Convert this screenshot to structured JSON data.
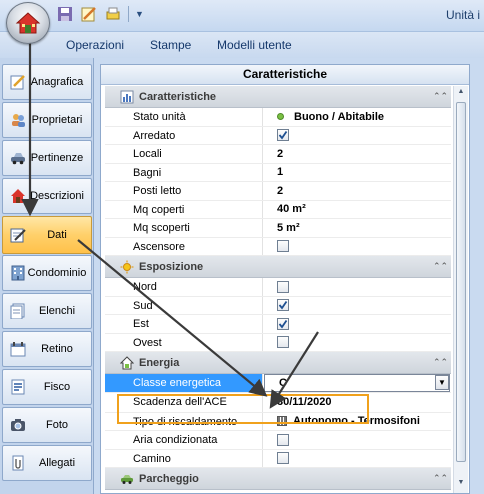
{
  "window": {
    "title": "Unità i"
  },
  "ribbon": {
    "tabs": [
      "Operazioni",
      "Stampe",
      "Modelli utente"
    ]
  },
  "nav": {
    "items": [
      {
        "label": "Anagrafica",
        "icon": "edit-icon"
      },
      {
        "label": "Proprietari",
        "icon": "people-icon"
      },
      {
        "label": "Pertinenze",
        "icon": "car-icon"
      },
      {
        "label": "Descrizioni",
        "icon": "house-icon"
      },
      {
        "label": "Dati",
        "icon": "notepad-icon",
        "active": true
      },
      {
        "label": "Condominio",
        "icon": "building-icon"
      },
      {
        "label": "Elenchi",
        "icon": "list-icon"
      },
      {
        "label": "Retino",
        "icon": "calendar-icon"
      },
      {
        "label": "Fisco",
        "icon": "fisco-icon"
      },
      {
        "label": "Foto",
        "icon": "camera-icon"
      },
      {
        "label": "Allegati",
        "icon": "attachment-icon"
      }
    ]
  },
  "panel": {
    "title": "Caratteristiche",
    "categories": [
      {
        "name": "Caratteristiche",
        "icon": "chart-icon",
        "rows": [
          {
            "key": "Stato unità",
            "value": "Buono / Abitabile",
            "type": "status"
          },
          {
            "key": "Arredato",
            "checked": true,
            "type": "check"
          },
          {
            "key": "Locali",
            "value": "2",
            "type": "text"
          },
          {
            "key": "Bagni",
            "value": "1",
            "type": "text"
          },
          {
            "key": "Posti letto",
            "value": "2",
            "type": "text"
          },
          {
            "key": "Mq coperti",
            "value": "40 m²",
            "type": "text"
          },
          {
            "key": "Mq scoperti",
            "value": "5 m²",
            "type": "text"
          },
          {
            "key": "Ascensore",
            "checked": false,
            "type": "check"
          }
        ]
      },
      {
        "name": "Esposizione",
        "icon": "sun-icon",
        "rows": [
          {
            "key": "Nord",
            "checked": false,
            "type": "check"
          },
          {
            "key": "Sud",
            "checked": true,
            "type": "check"
          },
          {
            "key": "Est",
            "checked": true,
            "type": "check"
          },
          {
            "key": "Ovest",
            "checked": false,
            "type": "check"
          }
        ]
      },
      {
        "name": "Energia",
        "icon": "energy-house-icon",
        "rows": [
          {
            "key": "Classe energetica",
            "value": "C",
            "type": "select",
            "selected": true
          },
          {
            "key": "Scadenza dell'ACE",
            "value": "30/11/2020",
            "type": "text"
          },
          {
            "key": "Tipo di riscaldamento",
            "value": "Autonomo - Termosifoni",
            "type": "heating"
          },
          {
            "key": "Aria condizionata",
            "checked": false,
            "type": "check"
          },
          {
            "key": "Camino",
            "checked": false,
            "type": "check"
          }
        ]
      },
      {
        "name": "Parcheggio",
        "icon": "car-icon",
        "rows": []
      }
    ]
  }
}
